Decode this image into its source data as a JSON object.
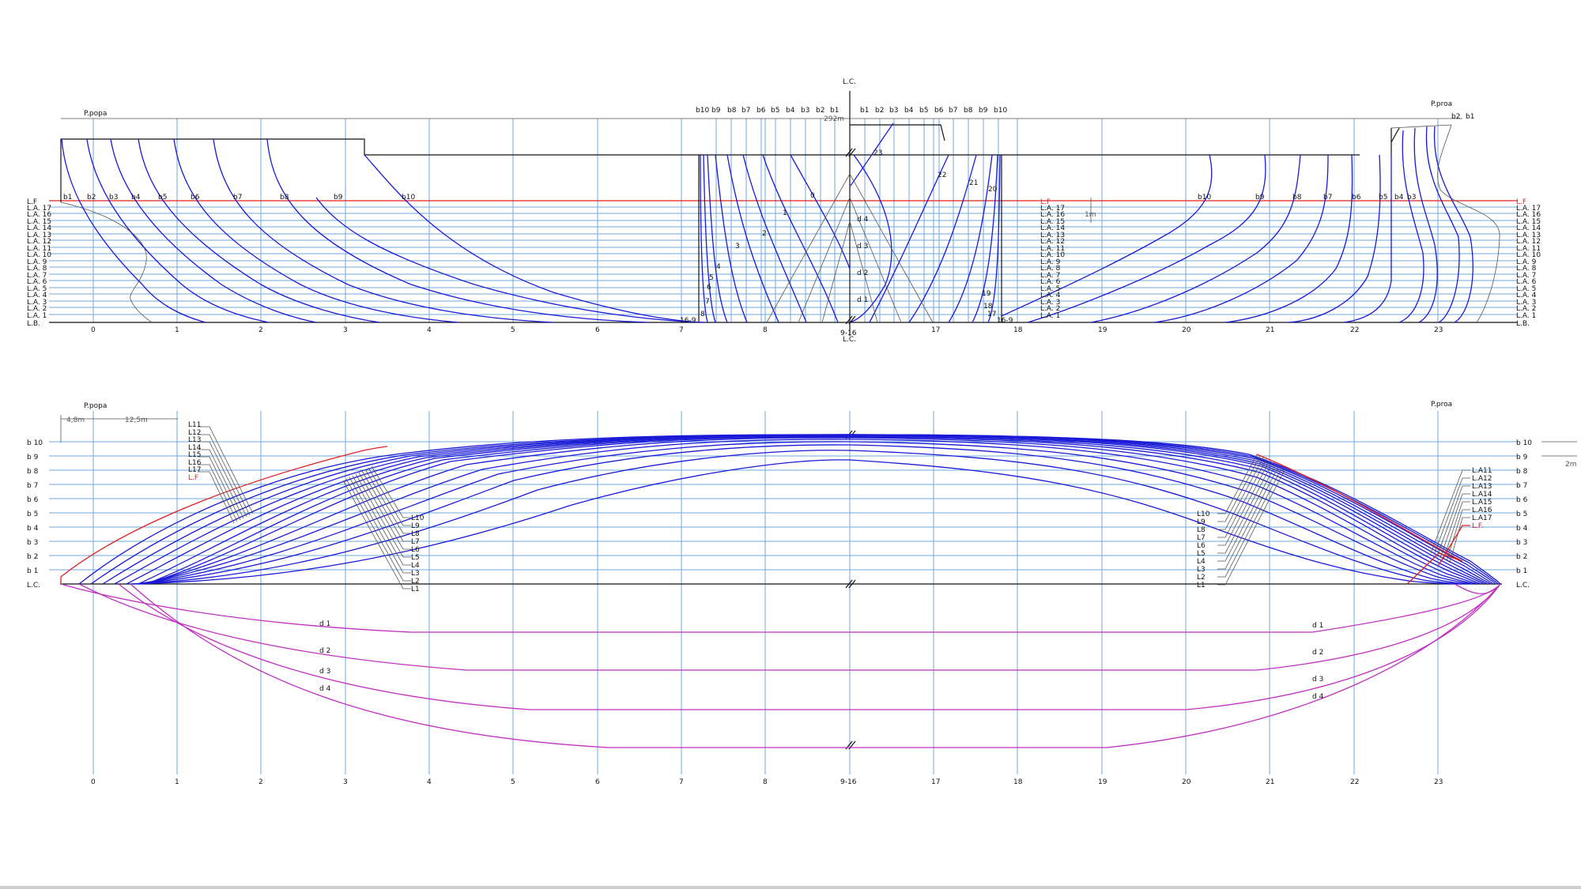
{
  "labels": {
    "lc": "L.C.",
    "lc_small": "L.C.",
    "stern": "P.popa",
    "bow": "P.proa",
    "length_dim": "292m",
    "dim_1m": "1m",
    "dim_48": "4,8m",
    "dim_125": "12,5m",
    "dim_2m": "2m",
    "lf": "L.F",
    "lf_plan": "L.F",
    "lf_plan_right": "L.F.",
    "lb": "L.B."
  },
  "stations": [
    "0",
    "1",
    "2",
    "3",
    "4",
    "5",
    "6",
    "7",
    "8",
    "9-16",
    "17",
    "18",
    "19",
    "20",
    "21",
    "22",
    "23"
  ],
  "waterlines": [
    "L.A. 17",
    "L.A. 16",
    "L.A. 15",
    "L.A. 14",
    "L.A. 13",
    "L.A. 12",
    "L.A. 11",
    "L.A. 10",
    "L.A. 9",
    "L.A. 8",
    "L.A. 7",
    "L.A. 6",
    "L.A. 5",
    "L.A. 4",
    "L.A. 3",
    "L.A. 2",
    "L.A. 1"
  ],
  "buttocks_plan": [
    "b 10",
    "b 9",
    "b 8",
    "b 7",
    "b 6",
    "b 5",
    "b 4",
    "b 3",
    "b 2",
    "b 1"
  ],
  "buttocks_profile_left": [
    "b1",
    "b2",
    "b3",
    "b4",
    "b5",
    "b6",
    "b7",
    "b8",
    "b9",
    "b10"
  ],
  "buttocks_profile_right": [
    "b10",
    "b9",
    "b8",
    "b7",
    "b6",
    "b5",
    "b4",
    "b3"
  ],
  "body_header_aft": [
    "b10",
    "b9",
    "b8",
    "b7",
    "b6",
    "b5",
    "b4",
    "b3",
    "b2",
    "b1"
  ],
  "body_header_fwd": [
    "b1",
    "b2",
    "b3",
    "b4",
    "b5",
    "b6",
    "b7",
    "b8",
    "b9",
    "b10"
  ],
  "bow_buttock_labels": [
    "b2",
    "b1"
  ],
  "body_station_labels_aft": [
    "1",
    "2",
    "3",
    "4",
    "5",
    "6",
    "7",
    "8",
    "16-9"
  ],
  "body_station_labels_fwd": [
    "23",
    "22",
    "21",
    "20",
    "19",
    "18",
    "17",
    "16-9"
  ],
  "body_station_center": "0",
  "diagonals_body": [
    "d 4",
    "d 3",
    "d 2",
    "d 1"
  ],
  "diagonals_plan": [
    "d 1",
    "d 2",
    "d 3",
    "d 4"
  ],
  "plan_wl_left_top": [
    "L11",
    "L12",
    "L13",
    "L14",
    "L15",
    "L16",
    "L17",
    "L.F"
  ],
  "plan_wl_left_low": [
    "L10",
    "L9",
    "L8",
    "L7",
    "L6",
    "L5",
    "L4",
    "L3",
    "L2",
    "L1"
  ],
  "plan_wl_right_top": [
    "L.A11",
    "L.A12",
    "L.A13",
    "L.A14",
    "L.A15",
    "L.A16",
    "L.A17",
    "L.F."
  ],
  "plan_wl_right_low": [
    "L10",
    "L9",
    "L8",
    "L7",
    "L6",
    "L5",
    "L4",
    "L3",
    "L2",
    "L1"
  ],
  "colors": {
    "grid": "#6fa8dc",
    "lines": "#1a1ad6",
    "diagonals": "#c030c0",
    "flotation": "#e02020",
    "hull": "#111111"
  }
}
